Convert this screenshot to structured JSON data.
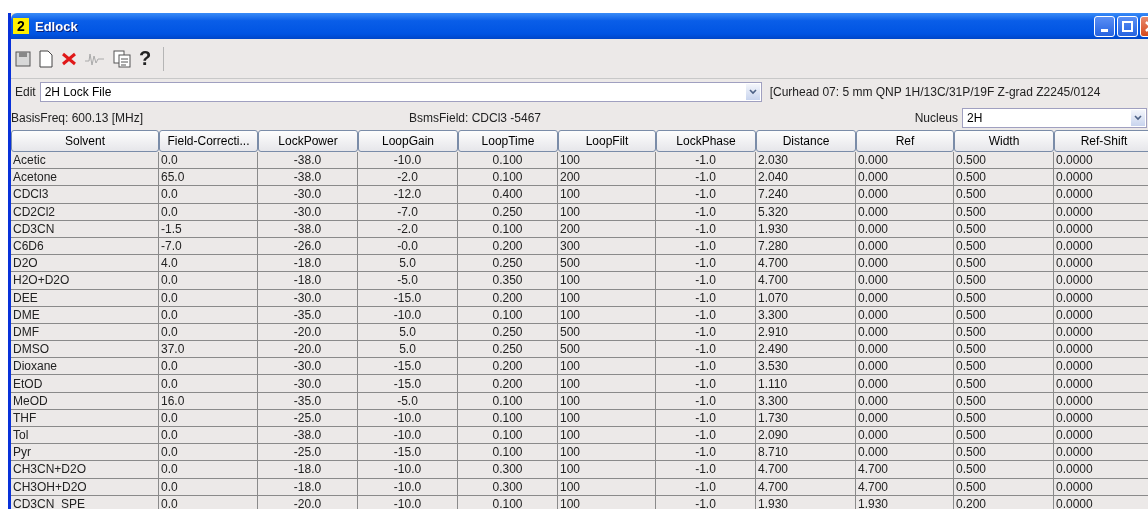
{
  "window": {
    "title": "Edlock",
    "badge": "2"
  },
  "toolbar": {
    "help": "?"
  },
  "edit": {
    "label": "Edit",
    "value": "2H Lock File",
    "probe_info": "[Curhead 07: 5 mm QNP  1H/13C/31P/19F Z-grad Z2245/0124"
  },
  "info": {
    "basis_freq": "BasisFreq: 600.13 [MHz]",
    "bsms_field": "BsmsField: CDCl3 -5467",
    "nucleus_label": "Nucleus",
    "nucleus": "2H"
  },
  "table": {
    "columns": [
      {
        "label": "Solvent"
      },
      {
        "label": "Field-Correcti..."
      },
      {
        "label": "LockPower"
      },
      {
        "label": "LoopGain"
      },
      {
        "label": "LoopTime"
      },
      {
        "label": "LoopFilt"
      },
      {
        "label": "LockPhase"
      },
      {
        "label": "Distance"
      },
      {
        "label": "Ref"
      },
      {
        "label": "Width"
      },
      {
        "label": "Ref-Shift"
      }
    ],
    "rows": [
      [
        "Acetic",
        "0.0",
        "-38.0",
        "-10.0",
        "0.100",
        "100",
        "-1.0",
        "2.030",
        "0.000",
        "0.500",
        "0.0000"
      ],
      [
        "Acetone",
        "65.0",
        "-38.0",
        "-2.0",
        "0.100",
        "200",
        "-1.0",
        "2.040",
        "0.000",
        "0.500",
        "0.0000"
      ],
      [
        "CDCl3",
        "0.0",
        "-30.0",
        "-12.0",
        "0.400",
        "100",
        "-1.0",
        "7.240",
        "0.000",
        "0.500",
        "0.0000"
      ],
      [
        "CD2Cl2",
        "0.0",
        "-30.0",
        "-7.0",
        "0.250",
        "100",
        "-1.0",
        "5.320",
        "0.000",
        "0.500",
        "0.0000"
      ],
      [
        "CD3CN",
        "-1.5",
        "-38.0",
        "-2.0",
        "0.100",
        "200",
        "-1.0",
        "1.930",
        "0.000",
        "0.500",
        "0.0000"
      ],
      [
        "C6D6",
        "-7.0",
        "-26.0",
        "-0.0",
        "0.200",
        "300",
        "-1.0",
        "7.280",
        "0.000",
        "0.500",
        "0.0000"
      ],
      [
        "D2O",
        "4.0",
        "-18.0",
        "5.0",
        "0.250",
        "500",
        "-1.0",
        "4.700",
        "0.000",
        "0.500",
        "0.0000"
      ],
      [
        "H2O+D2O",
        "0.0",
        "-18.0",
        "-5.0",
        "0.350",
        "100",
        "-1.0",
        "4.700",
        "0.000",
        "0.500",
        "0.0000"
      ],
      [
        "DEE",
        "0.0",
        "-30.0",
        "-15.0",
        "0.200",
        "100",
        "-1.0",
        "1.070",
        "0.000",
        "0.500",
        "0.0000"
      ],
      [
        "DME",
        "0.0",
        "-35.0",
        "-10.0",
        "0.100",
        "100",
        "-1.0",
        "3.300",
        "0.000",
        "0.500",
        "0.0000"
      ],
      [
        "DMF",
        "0.0",
        "-20.0",
        "5.0",
        "0.250",
        "500",
        "-1.0",
        "2.910",
        "0.000",
        "0.500",
        "0.0000"
      ],
      [
        "DMSO",
        "37.0",
        "-20.0",
        "5.0",
        "0.250",
        "500",
        "-1.0",
        "2.490",
        "0.000",
        "0.500",
        "0.0000"
      ],
      [
        "Dioxane",
        "0.0",
        "-30.0",
        "-15.0",
        "0.200",
        "100",
        "-1.0",
        "3.530",
        "0.000",
        "0.500",
        "0.0000"
      ],
      [
        "EtOD",
        "0.0",
        "-30.0",
        "-15.0",
        "0.200",
        "100",
        "-1.0",
        "1.110",
        "0.000",
        "0.500",
        "0.0000"
      ],
      [
        "MeOD",
        "16.0",
        "-35.0",
        "-5.0",
        "0.100",
        "100",
        "-1.0",
        "3.300",
        "0.000",
        "0.500",
        "0.0000"
      ],
      [
        "THF",
        "0.0",
        "-25.0",
        "-10.0",
        "0.100",
        "100",
        "-1.0",
        "1.730",
        "0.000",
        "0.500",
        "0.0000"
      ],
      [
        "Tol",
        "0.0",
        "-38.0",
        "-10.0",
        "0.100",
        "100",
        "-1.0",
        "2.090",
        "0.000",
        "0.500",
        "0.0000"
      ],
      [
        "Pyr",
        "0.0",
        "-25.0",
        "-15.0",
        "0.100",
        "100",
        "-1.0",
        "8.710",
        "0.000",
        "0.500",
        "0.0000"
      ],
      [
        "CH3CN+D2O",
        "0.0",
        "-18.0",
        "-10.0",
        "0.300",
        "100",
        "-1.0",
        "4.700",
        "4.700",
        "0.500",
        "0.0000"
      ],
      [
        "CH3OH+D2O",
        "0.0",
        "-18.0",
        "-10.0",
        "0.300",
        "100",
        "-1.0",
        "4.700",
        "4.700",
        "0.500",
        "0.0000"
      ],
      [
        "CD3CN_SPE",
        "0.0",
        "-20.0",
        "-10.0",
        "0.100",
        "100",
        "-1.0",
        "1.930",
        "1.930",
        "0.200",
        "0.0000"
      ]
    ]
  }
}
